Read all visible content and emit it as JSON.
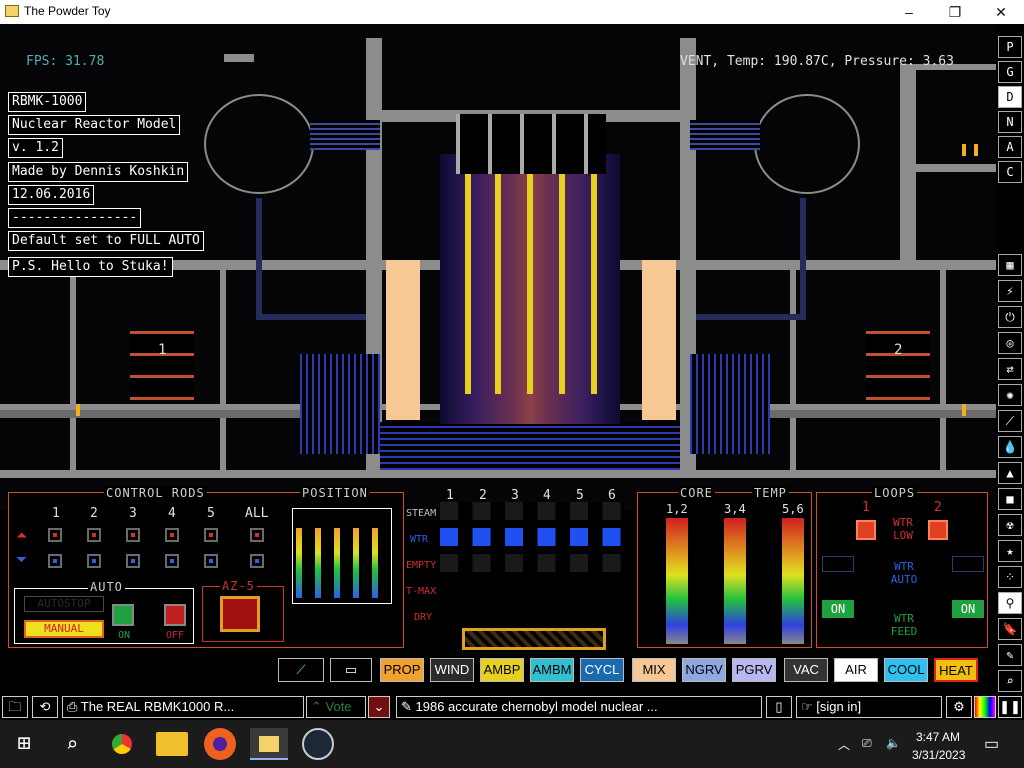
{
  "window": {
    "title": "The Powder Toy",
    "minimize": "–",
    "maximize": "❐",
    "close": "✕"
  },
  "hud": {
    "fps": "FPS: 31.78",
    "vent": "VENT, Temp: 190.87C, Pressure: 3.63"
  },
  "info_labels": [
    "RBMK-1000",
    "Nuclear Reactor Model",
    "v. 1.2",
    "Made by Dennis Koshkin",
    "12.06.2016",
    "----------------",
    "Default set to FULL AUTO",
    "P.S. Hello to Stuka!"
  ],
  "reactor_labels": {
    "left": "1",
    "right": "2"
  },
  "control_rods": {
    "title": "CONTROL RODS",
    "numbers": [
      "1",
      "2",
      "3",
      "4",
      "5",
      "ALL"
    ],
    "auto_title": "AUTO",
    "autostop": "AUTOSTOP",
    "manual": "MANUAL",
    "on": "ON",
    "off": "OFF",
    "az5": "AZ-5"
  },
  "position": {
    "title": "POSITION"
  },
  "status": {
    "numbers": [
      "1",
      "2",
      "3",
      "4",
      "5",
      "6"
    ],
    "rows": [
      "STEAM",
      "WTR",
      "EMPTY",
      "T-MAX",
      "DRY"
    ]
  },
  "core_temp": {
    "title1": "CORE",
    "title2": "TEMP",
    "cols": [
      "1,2",
      "3,4",
      "5,6"
    ]
  },
  "loops": {
    "title": "LOOPS",
    "n1": "1",
    "n2": "2",
    "wtr_low": "WTR LOW",
    "wtr_auto": "WTR AUTO",
    "wtr_feed": "WTR FEED",
    "on": "ON",
    "on2": "ON"
  },
  "element_buttons": [
    {
      "label": "PROP",
      "bg": "#f2a030"
    },
    {
      "label": "WIND",
      "bg": "#2a2a2a",
      "fg": "#fff"
    },
    {
      "label": "AMBP",
      "bg": "#e8d020"
    },
    {
      "label": "AMBM",
      "bg": "#30c0d0"
    },
    {
      "label": "CYCL",
      "bg": "#1a6ab0",
      "fg": "#fff"
    },
    {
      "label": "MIX",
      "bg": "#f5c896"
    },
    {
      "label": "NGRV",
      "bg": "#90a8e0"
    },
    {
      "label": "PGRV",
      "bg": "#b8b8f0"
    },
    {
      "label": "VAC",
      "bg": "#333",
      "fg": "#fff"
    },
    {
      "label": "AIR",
      "bg": "#fff"
    },
    {
      "label": "COOL",
      "bg": "#30c0f0"
    },
    {
      "label": "HEAT",
      "bg": "#f0c010"
    }
  ],
  "right_menu_top": [
    "P",
    "G",
    "D",
    "N",
    "A",
    "C"
  ],
  "bottom_bar": {
    "save_name": "The REAL RBMK1000 R...",
    "vote": "Vote",
    "tags": "1986 accurate chernobyl model nuclear ...",
    "sign_in": "[sign in]"
  },
  "taskbar": {
    "time": "3:47 AM",
    "date": "3/31/2023"
  }
}
